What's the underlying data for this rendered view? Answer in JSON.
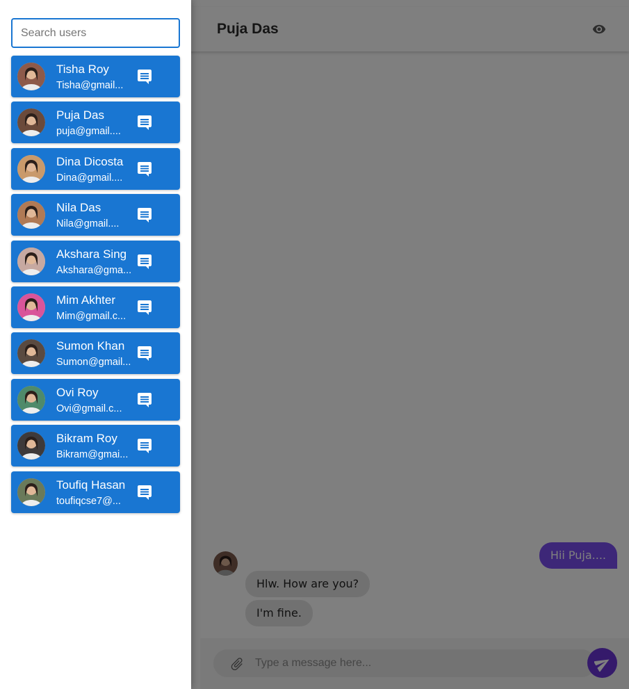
{
  "chat": {
    "title": "Puja Das",
    "header_icon": "eye-icon",
    "messages": [
      {
        "direction": "outgoing",
        "text": "Hii Puja...."
      },
      {
        "direction": "incoming",
        "text": "Hlw. How are you?"
      },
      {
        "direction": "incoming",
        "text": "I'm fine."
      }
    ],
    "composer": {
      "placeholder": "Type a message here...",
      "attach_icon": "paperclip-icon",
      "send_icon": "send-icon"
    }
  },
  "drawer": {
    "search_placeholder": "Search users",
    "users": [
      {
        "name": "Tisha Roy",
        "email": "Tisha@gmail...",
        "avatar_color": "#8d5a4a"
      },
      {
        "name": "Puja Das",
        "email": "puja@gmail....",
        "avatar_color": "#6b4a3a"
      },
      {
        "name": "Dina Dicosta",
        "email": "Dina@gmail....",
        "avatar_color": "#c99a6b"
      },
      {
        "name": "Nila Das",
        "email": "Nila@gmail....",
        "avatar_color": "#b07a55"
      },
      {
        "name": "Akshara Sing",
        "email": "Akshara@gma...",
        "avatar_color": "#c7a9a1"
      },
      {
        "name": "Mim Akhter",
        "email": "Mim@gmail.c...",
        "avatar_color": "#d9559a"
      },
      {
        "name": "Sumon Khan",
        "email": "Sumon@gmail...",
        "avatar_color": "#5a4a40"
      },
      {
        "name": "Ovi Roy",
        "email": "Ovi@gmail.c...",
        "avatar_color": "#4f8a6a"
      },
      {
        "name": "Bikram Roy",
        "email": "Bikram@gmai...",
        "avatar_color": "#3e3a3a"
      },
      {
        "name": "Toufiq Hasan",
        "email": "toufiqcse7@...",
        "avatar_color": "#6a7a5a"
      }
    ],
    "user_action_icon": "chat-icon"
  },
  "colors": {
    "card": "#1976d2",
    "outgoing_bubble": "#7a4ef0",
    "incoming_bubble": "#e3e3e3",
    "send_button": "#6a35d6"
  }
}
